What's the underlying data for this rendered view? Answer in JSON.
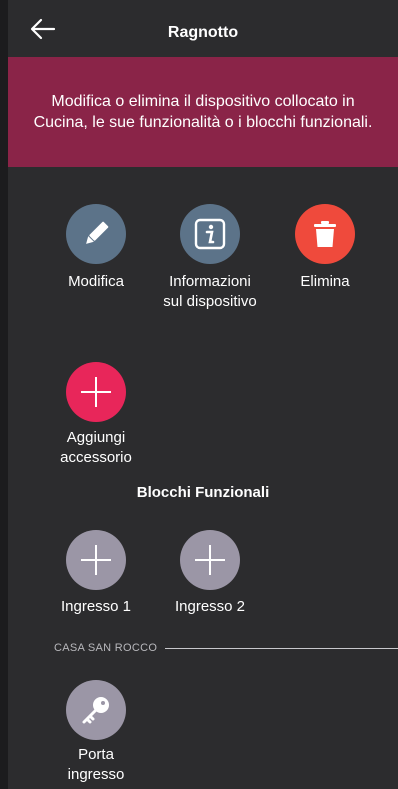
{
  "header": {
    "title": "Ragnotto",
    "back_icon": "arrow-left-icon"
  },
  "banner": {
    "text": "Modifica o elimina il dispositivo collocato in Cucina, le sue funzionalità o i blocchi funzionali."
  },
  "actions": [
    {
      "label": "Modifica",
      "icon": "pencil-icon",
      "color": "#5c7389"
    },
    {
      "label_line1": "Informazioni",
      "label_line2": "sul dispositivo",
      "icon": "info-icon",
      "color": "#5c7389"
    },
    {
      "label": "Elimina",
      "icon": "trash-icon",
      "color": "#ef4a3c"
    }
  ],
  "accessory": {
    "label_line1": "Aggiungi",
    "label_line2": "accessorio",
    "icon": "plus-icon",
    "color": "#e8265a"
  },
  "functional_blocks": {
    "title": "Blocchi Funzionali",
    "items": [
      {
        "label": "Ingresso 1",
        "icon": "plus-icon"
      },
      {
        "label": "Ingresso 2",
        "icon": "plus-icon"
      }
    ]
  },
  "group": {
    "label": "CASA SAN ROCCO",
    "items": [
      {
        "label_line1": "Porta",
        "label_line2": "ingresso",
        "icon": "key-icon"
      }
    ]
  }
}
